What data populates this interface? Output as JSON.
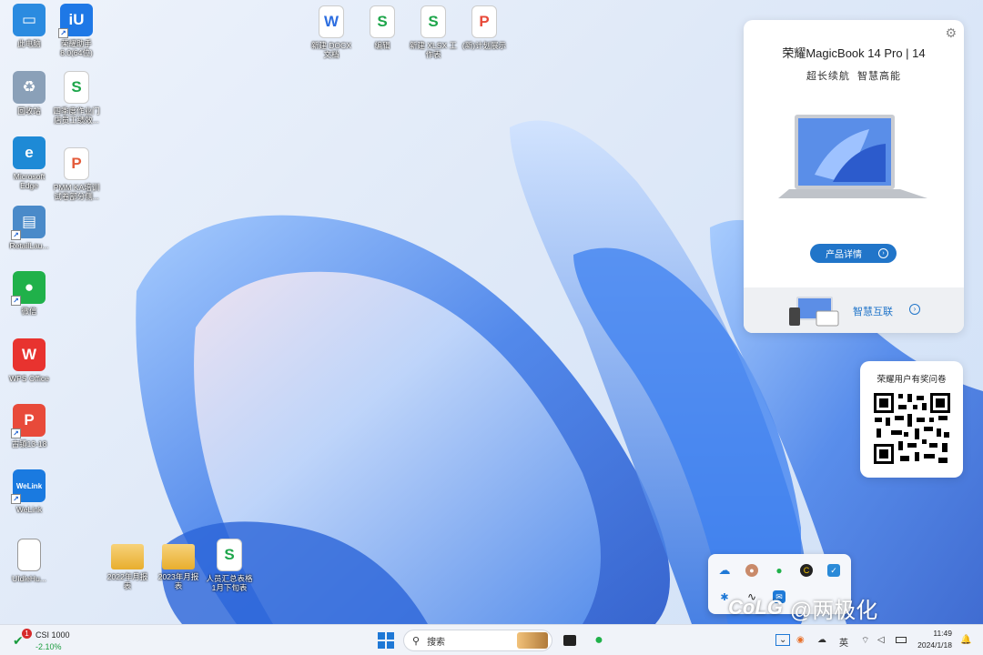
{
  "desktop_icons": [
    {
      "name": "this-pc",
      "label": "此电脑",
      "glyph": "▭",
      "color": "#2b8be0"
    },
    {
      "name": "honor-assistant",
      "label": "荣耀助手\n8.0(64位)",
      "glyph": "iU",
      "color": "#1e78e6"
    },
    {
      "name": "recycle-bin",
      "label": "回收站",
      "glyph": "♻",
      "color": "#8aa0b8"
    },
    {
      "name": "sheet-file-1",
      "label": "四季度作业门\n店员工绩效...",
      "glyph": "S",
      "color": "#1ea64b"
    },
    {
      "name": "edge",
      "label": "Microsoft\nEdge",
      "glyph": "e",
      "color": "#1e8ad6"
    },
    {
      "name": "ppt-file-1",
      "label": "PMM KA培训\n试卷部分侧...",
      "glyph": "P",
      "color": "#e45b3a"
    },
    {
      "name": "retail-launcher",
      "label": "RetailLau...",
      "glyph": "▤",
      "color": "#4a8ac9"
    },
    {
      "name": "wechat",
      "label": "微信",
      "glyph": "●",
      "color": "#20b14a"
    },
    {
      "name": "wps-office",
      "label": "WPS Office",
      "glyph": "W",
      "color": "#e8332f"
    },
    {
      "name": "pdf-file",
      "label": "古镇13-18",
      "glyph": "P",
      "color": "#e84a3a"
    },
    {
      "name": "welink",
      "label": "WeLink",
      "glyph": "WeLink",
      "color": "#1a7ae0"
    },
    {
      "name": "text-file",
      "label": "UIdleHu...",
      "glyph": "",
      "color": "#ffffff"
    },
    {
      "name": "new-docx",
      "label": "新建 DOCX\n文档",
      "glyph": "W",
      "color": "#2d6ee0"
    },
    {
      "name": "sheet-file-2",
      "label": "编辑",
      "glyph": "S",
      "color": "#1ea64b"
    },
    {
      "name": "new-xlsx",
      "label": "新建 XLSX 工\n作表",
      "glyph": "S",
      "color": "#1ea64b"
    },
    {
      "name": "ppt-file-2",
      "label": "(新)计划展示",
      "glyph": "P",
      "color": "#e84a3a"
    },
    {
      "name": "folder-2022",
      "label": "2022年月报\n表",
      "glyph": "",
      "color": "#f2c04a"
    },
    {
      "name": "folder-2023",
      "label": "2023年月报\n表",
      "glyph": "",
      "color": "#f2c04a"
    },
    {
      "name": "sheet-file-3",
      "label": "人员汇总表格\n1月下旬表",
      "glyph": "S",
      "color": "#1ea64b"
    }
  ],
  "promo": {
    "title": "荣耀MagicBook 14 Pro | 14",
    "subtitle": "超长续航  智慧高能",
    "detail_button": "产品详情",
    "footer_label": "智慧互联"
  },
  "survey": {
    "title": "荣耀用户有奖问卷"
  },
  "taskbar": {
    "stock_name": "CSI 1000",
    "stock_change": "-2.10%",
    "stock_badge": "1",
    "search_placeholder": "搜索",
    "language": "英",
    "time": "11:49",
    "date": "2024/1/18"
  },
  "watermark": "@两极化",
  "watermark_logo": "CoLG",
  "colors": {
    "accent": "#1e6fd9",
    "stock_down": "#1a9c3e"
  }
}
